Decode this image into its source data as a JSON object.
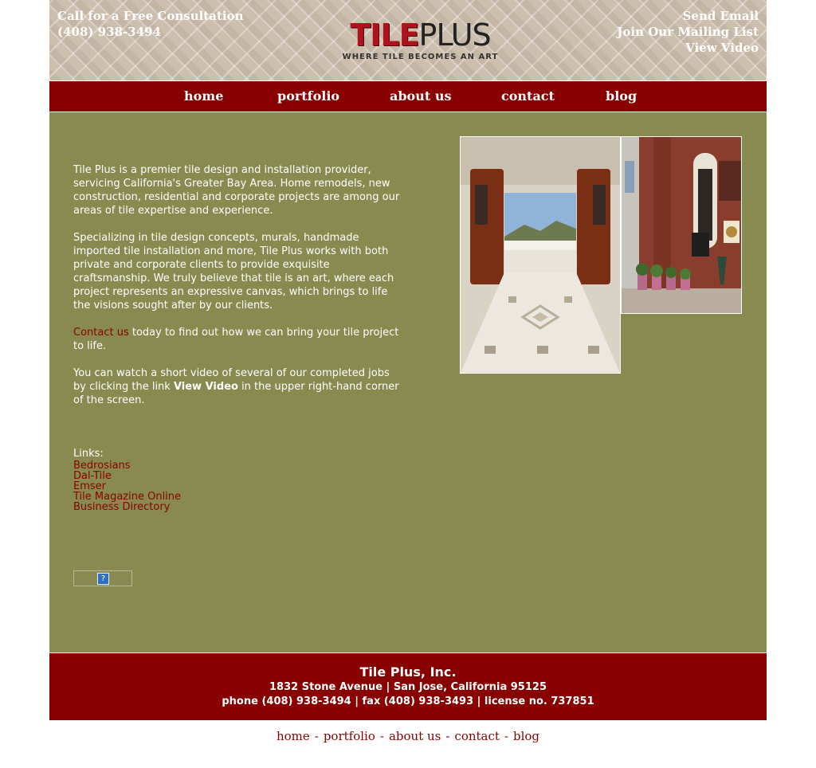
{
  "header": {
    "consult_label": "Call for a Free Consultation",
    "phone": "(408) 938-3494",
    "logo_tile": "TILE",
    "logo_plus": "PLUS",
    "tagline": "WHERE TILE BECOMES AN ART",
    "send_email": "Send Email",
    "mailing_list": "Join Our Mailing List",
    "view_video": "View Video"
  },
  "nav": {
    "items": [
      {
        "label": "home"
      },
      {
        "label": "portfolio"
      },
      {
        "label": "about us"
      },
      {
        "label": "contact"
      },
      {
        "label": "blog"
      }
    ]
  },
  "main": {
    "p1": "Tile Plus is a premier tile design and installation provider, servicing California's Greater Bay Area. Home remodels, new construction, residential and corporate projects are among our areas of tile expertise and experience.",
    "p2": "Specializing in tile design concepts, murals, handmade imported tile installation and more, Tile Plus works with both private and corporate clients to provide exquisite craftsmanship. We truly believe that tile is an art, where each project represents an expressive canvas, which brings to life the visions sought after by our clients.",
    "p3_link": "Contact us",
    "p3_text": " today to find out how we can bring your tile project to life.",
    "p4_before": "You can watch a short video of several of our completed jobs by clicking the link ",
    "p4_bold": "View Video",
    "p4_after": " in the upper right-hand corner of the screen.",
    "links_label": "Links:",
    "links": [
      "Bedrosians",
      "Dal-Tile",
      "Emser",
      "Tile Magazine Online",
      "Business Directory"
    ],
    "widget_glyph": "?"
  },
  "footer": {
    "company": "Tile Plus, Inc.",
    "address": "1832 Stone Avenue | San Jose, California 95125",
    "contact": "phone (408) 938-3494 | fax (408) 938-3493 | license no. 737851"
  },
  "bottom_nav": {
    "items": [
      "home",
      "portfolio",
      "about us",
      "contact",
      "blog"
    ],
    "separator": "-"
  },
  "colors": {
    "brand_red": "#880000",
    "link_red": "#8a0000",
    "content_green": "#888a50"
  }
}
